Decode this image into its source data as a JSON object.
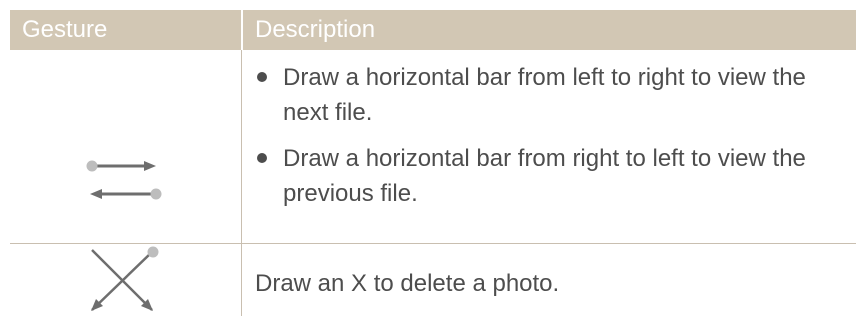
{
  "header": {
    "gesture": "Gesture",
    "description": "Description"
  },
  "rows": [
    {
      "icons": [
        "swipe-right-gesture-icon",
        "swipe-left-gesture-icon"
      ],
      "bullets": [
        "Draw a horizontal bar from left to right to view the next file.",
        "Draw a horizontal bar from right to left to view the previous file."
      ]
    },
    {
      "icons": [
        "x-gesture-icon"
      ],
      "text": "Draw an X to delete a photo."
    }
  ],
  "colors": {
    "header_bg": "#d2c7b4",
    "text": "#4d4d4d",
    "rule": "#c9bfb0",
    "icon_line": "#6e6e6e",
    "icon_dot": "#bdbdbd"
  }
}
